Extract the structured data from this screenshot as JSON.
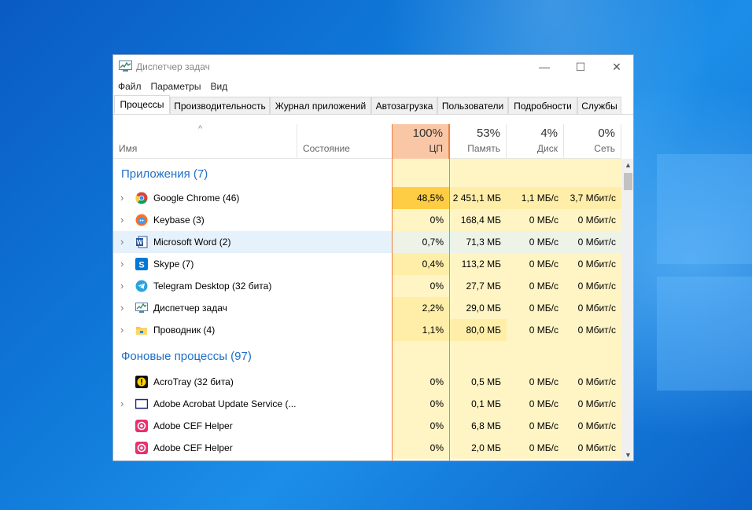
{
  "window": {
    "title": "Диспетчер задач",
    "controls": {
      "minimize": "—",
      "maximize": "☐",
      "close": "✕"
    }
  },
  "menu": [
    "Файл",
    "Параметры",
    "Вид"
  ],
  "tabs": [
    "Процессы",
    "Производительность",
    "Журнал приложений",
    "Автозагрузка",
    "Пользователи",
    "Подробности",
    "Службы"
  ],
  "active_tab": "Процессы",
  "columns": {
    "name": "Имя",
    "status": "Состояние",
    "cpu": {
      "pct": "100%",
      "label": "ЦП"
    },
    "memory": {
      "pct": "53%",
      "label": "Память"
    },
    "disk": {
      "pct": "4%",
      "label": "Диск"
    },
    "network": {
      "pct": "0%",
      "label": "Сеть"
    }
  },
  "groups": {
    "apps": "Приложения (7)",
    "background": "Фоновые процессы (97)"
  },
  "processes": [
    {
      "name": "Google Chrome (46)",
      "icon": "chrome-icon",
      "cpu": "48,5%",
      "mem": "2 451,1 МБ",
      "disk": "1,1 МБ/с",
      "net": "3,7 Мбит/с"
    },
    {
      "name": "Keybase (3)",
      "icon": "keybase-icon",
      "cpu": "0%",
      "mem": "168,4 МБ",
      "disk": "0 МБ/с",
      "net": "0 Мбит/с"
    },
    {
      "name": "Microsoft Word (2)",
      "icon": "word-icon",
      "cpu": "0,7%",
      "mem": "71,3 МБ",
      "disk": "0 МБ/с",
      "net": "0 Мбит/с"
    },
    {
      "name": "Skype (7)",
      "icon": "skype-icon",
      "cpu": "0,4%",
      "mem": "113,2 МБ",
      "disk": "0 МБ/с",
      "net": "0 Мбит/с"
    },
    {
      "name": "Telegram Desktop (32 бита)",
      "icon": "telegram-icon",
      "cpu": "0%",
      "mem": "27,7 МБ",
      "disk": "0 МБ/с",
      "net": "0 Мбит/с"
    },
    {
      "name": "Диспетчер задач",
      "icon": "task-manager-icon",
      "cpu": "2,2%",
      "mem": "29,0 МБ",
      "disk": "0 МБ/с",
      "net": "0 Мбит/с"
    },
    {
      "name": "Проводник (4)",
      "icon": "explorer-icon",
      "cpu": "1,1%",
      "mem": "80,0 МБ",
      "disk": "0 МБ/с",
      "net": "0 Мбит/с"
    },
    {
      "name": "AcroTray (32 бита)",
      "icon": "acrotray-icon",
      "cpu": "0%",
      "mem": "0,5 МБ",
      "disk": "0 МБ/с",
      "net": "0 Мбит/с"
    },
    {
      "name": "Adobe Acrobat Update Service (...",
      "icon": "acrobat-update-icon",
      "cpu": "0%",
      "mem": "0,1 МБ",
      "disk": "0 МБ/с",
      "net": "0 Мбит/с"
    },
    {
      "name": "Adobe CEF Helper",
      "icon": "adobe-cef-icon",
      "cpu": "0%",
      "mem": "6,8 МБ",
      "disk": "0 МБ/с",
      "net": "0 Мбит/с"
    },
    {
      "name": "Adobe CEF Helper",
      "icon": "adobe-cef-icon",
      "cpu": "0%",
      "mem": "2,0 МБ",
      "disk": "0 МБ/с",
      "net": "0 Мбит/с"
    }
  ],
  "scroll": {
    "up": "▲",
    "down": "▼"
  },
  "colors": {
    "cpu_header": "#f9c7a6",
    "cpu_high": "#ffcd44",
    "heat_light": "#fff4c4",
    "group_title": "#1e6fc8",
    "selected_row": "#e5f1fb"
  }
}
